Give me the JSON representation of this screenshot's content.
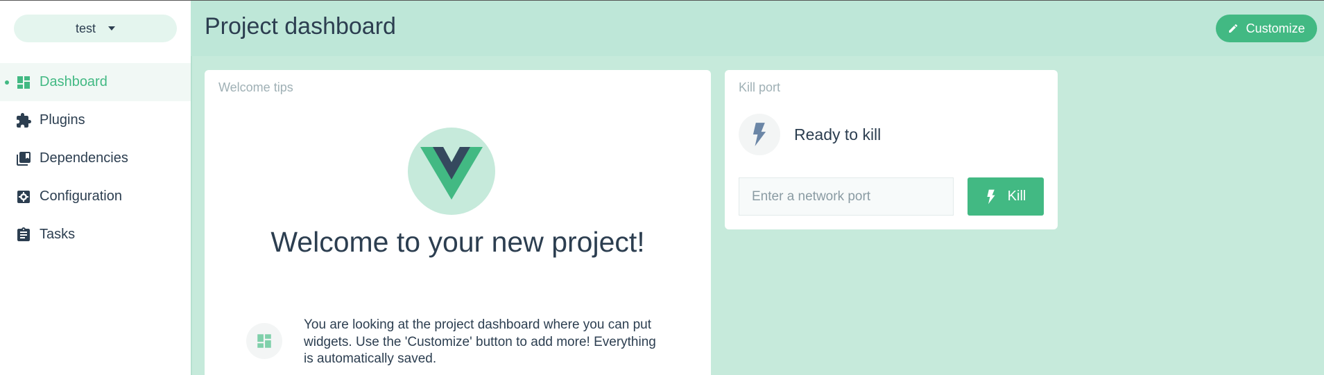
{
  "project_switcher": {
    "label": "test",
    "icon": "chevron-down-icon"
  },
  "nav": {
    "items": [
      {
        "label": "Dashboard",
        "icon": "dashboard-icon",
        "active": true
      },
      {
        "label": "Plugins",
        "icon": "puzzle-icon"
      },
      {
        "label": "Dependencies",
        "icon": "library-icon"
      },
      {
        "label": "Configuration",
        "icon": "settings-icon"
      },
      {
        "label": "Tasks",
        "icon": "clipboard-icon"
      }
    ]
  },
  "header": {
    "title": "Project dashboard",
    "customize_label": "Customize",
    "customize_icon": "pencil-icon"
  },
  "welcome_card": {
    "title": "Welcome tips",
    "heading": "Welcome to your new project!",
    "tip": "You are looking at the project dashboard where you can put widgets. Use the 'Customize' button to add more! Everything is automatically saved.",
    "tip_icon": "dashboard-icon",
    "logo": "vue-logo"
  },
  "kill_card": {
    "title": "Kill port",
    "status": "Ready to kill",
    "status_icon": "lightning-icon",
    "input_placeholder": "Enter a network port",
    "input_value": "",
    "button_label": "Kill",
    "button_icon": "lightning-icon"
  },
  "colors": {
    "accent": "#42b983",
    "vue_dark": "#35495e",
    "main_bg": "#c6eadb",
    "header_bg": "#bee7d8",
    "text": "#2c3e50"
  }
}
